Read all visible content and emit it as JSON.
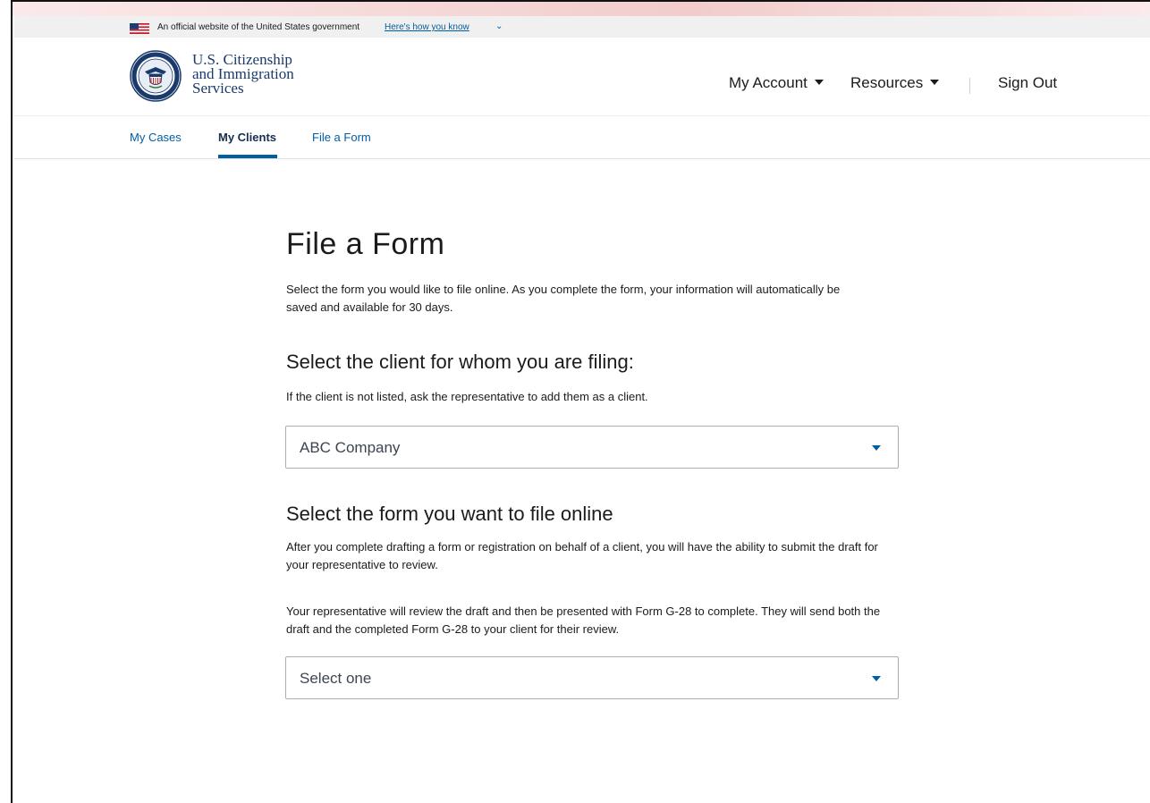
{
  "gov_banner": {
    "text": "An official website of the United States government",
    "link": "Here's how you know",
    "chevron_icon": "chevron-down-icon"
  },
  "agency": {
    "line1": "U.S. Citizenship",
    "line2": "and Immigration",
    "line3": "Services",
    "seal_icon": "dhs-seal-icon"
  },
  "top_nav": {
    "my_account": "My Account",
    "resources": "Resources",
    "sign_out": "Sign Out"
  },
  "sub_nav": {
    "items": [
      {
        "label": "My Cases",
        "active": false
      },
      {
        "label": "My Clients",
        "active": true
      },
      {
        "label": "File a Form",
        "active": false
      }
    ]
  },
  "main": {
    "title": "File a Form",
    "intro": "Select the form you would like to file online. As you complete the form, your information will automatically be saved and available for 30 days.",
    "client_section": {
      "heading": "Select the client for whom you are filing:",
      "help": "If the client is not listed, ask the representative to add them as a client.",
      "selected_value": "ABC Company"
    },
    "form_section": {
      "heading": "Select the form you want to file online",
      "paragraph1": "After you complete drafting a form or registration on behalf of a client, you will have the ability to submit the draft for your representative to review.",
      "paragraph2": "Your representative will review the draft and then be presented with Form G-28 to complete. They will send both the draft and the completed Form G-28 to your client for their review.",
      "placeholder": "Select one"
    }
  },
  "colors": {
    "link_blue": "#005ea2",
    "agency_navy": "#1a3a6b",
    "active_tab": "#162e51",
    "text": "#1b1b1b"
  }
}
